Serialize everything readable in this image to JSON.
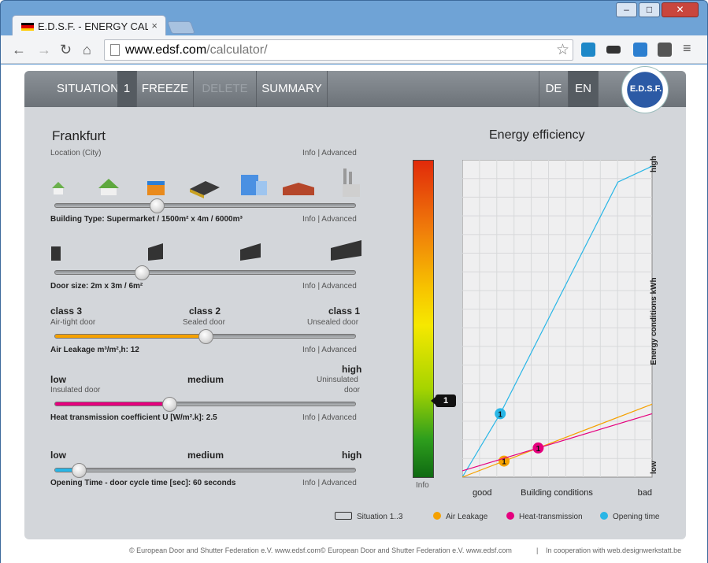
{
  "browser": {
    "tab_title": "E.D.S.F. - ENERGY CALC",
    "tab_close": "×",
    "url_host": "www.edsf.com",
    "url_path": "/calculator/",
    "win_min": "–",
    "win_max": "□",
    "win_close": "✕"
  },
  "menu": {
    "situation": "SITUATION",
    "number": "1",
    "freeze": "FREEZE",
    "delete": "DELETE",
    "summary": "SUMMARY",
    "lang_de": "DE",
    "lang_en": "EN",
    "logo": "E.D.S.F."
  },
  "location": {
    "city": "Frankfurt",
    "label": "Location (City)",
    "info": "Info | Advanced"
  },
  "building": {
    "label": "Building Type: Supermarket / 1500m² x 4m / 6000m³",
    "info": "Info | Advanced",
    "level": 0.34
  },
  "door": {
    "label": "Door size: 2m x 3m / 6m²",
    "info": "Info | Advanced",
    "level": 0.29
  },
  "air": {
    "c1": "class 3",
    "c1s": "Air-tight door",
    "c2": "class 2",
    "c2s": "Sealed door",
    "c3": "class 1",
    "c3s": "Unsealed door",
    "label": "Air Leakage m³/m²,h: 12",
    "info": "Info | Advanced",
    "level": 0.5,
    "color": "#f5a100"
  },
  "heat": {
    "low": "low",
    "lows": "Insulated door",
    "medium": "medium",
    "high": "high",
    "highs1": "Uninsulated",
    "highs2": "door",
    "label": "Heat transmission coefficient U [W/m².k]: 2.5",
    "info": "Info | Advanced",
    "level": 0.38,
    "color": "#e5007e"
  },
  "opening": {
    "low": "low",
    "medium": "medium",
    "high": "high",
    "label": "Opening Time - door cycle time [sec]: 60 seconds",
    "info": "Info | Advanced",
    "level": 0.08,
    "color": "#29b6e6"
  },
  "efficiency": {
    "title": "Energy efficiency",
    "bar_info": "Info",
    "pointer": "1"
  },
  "chart_data": {
    "type": "line",
    "xlabel": "Building conditions",
    "ylabel": "Energy conditions kWh",
    "x_low": "good",
    "x_high": "bad",
    "y_low": "low",
    "y_high": "high",
    "series": [
      {
        "name": "Opening time",
        "color": "#29b6e6",
        "points": [
          [
            0,
            0
          ],
          [
            0.2,
            0.2
          ],
          [
            0.82,
            0.93
          ],
          [
            1,
            0.98
          ]
        ],
        "marker_x": 0.2,
        "marker": "1"
      },
      {
        "name": "Air Leakage",
        "color": "#f5a100",
        "points": [
          [
            0,
            0
          ],
          [
            1,
            0.23
          ]
        ],
        "marker_x": 0.22,
        "marker": "1"
      },
      {
        "name": "Heat-transmission",
        "color": "#e5007e",
        "points": [
          [
            0,
            0.02
          ],
          [
            1,
            0.2
          ]
        ],
        "marker_x": 0.4,
        "marker": "1"
      }
    ]
  },
  "legend": {
    "situation": "Situation 1..3",
    "air": "Air Leakage",
    "heat": "Heat-transmission",
    "opening": "Opening time"
  },
  "footer": {
    "left": "© European Door and Shutter Federation e.V. www.edsf.com© European Door and Shutter Federation e.V. www.edsf.com",
    "sep": "|",
    "right": "In cooperation with web.designwerkstatt.be"
  }
}
